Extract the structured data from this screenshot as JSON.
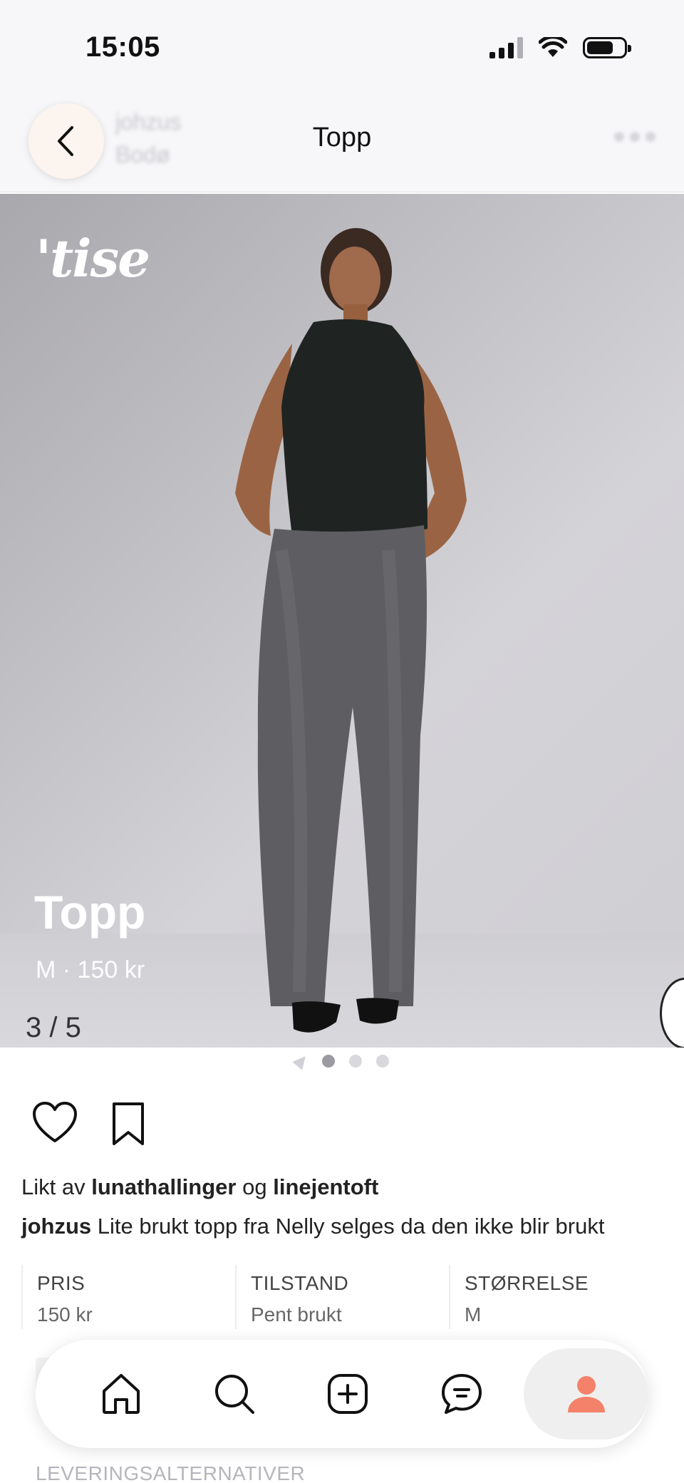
{
  "status_bar": {
    "time": "15:05"
  },
  "header": {
    "seller_name": "johzus",
    "seller_location": "Bodø",
    "title": "Topp"
  },
  "hero": {
    "logo_text": "'tise",
    "title": "Topp",
    "subtitle": "M · 150 kr",
    "counter": "3 / 5"
  },
  "pager": {
    "dot_count": 3,
    "active_index": 0
  },
  "social": {
    "liked_prefix": "Likt av",
    "liked_user_1": "lunathallinger",
    "liked_join": "og",
    "liked_user_2": "linejentoft",
    "caption_user": "johzus",
    "caption_text": "Lite brukt topp fra Nelly selges da den ikke blir brukt"
  },
  "details": [
    {
      "label": "PRIS",
      "value": "150 kr"
    },
    {
      "label": "TILSTAND",
      "value": "Pent brukt"
    },
    {
      "label": "STØRRELSE",
      "value": "M"
    }
  ],
  "delivery_label": "LEVERINGSALTERNATIVER",
  "bottom_nav": {
    "items": [
      "home-icon",
      "search-icon",
      "add-icon",
      "chat-icon",
      "profile-icon"
    ],
    "active_item": "profile-icon",
    "accent_color": "#f4826a"
  }
}
